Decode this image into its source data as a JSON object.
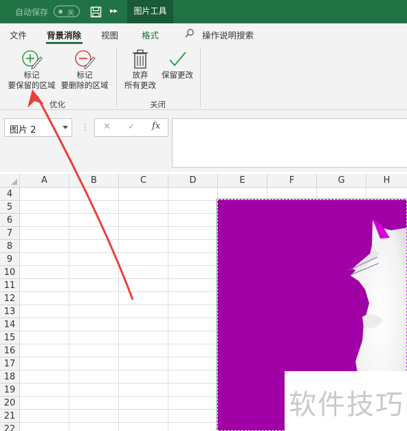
{
  "titlebar": {
    "autosave_label": "自动保存",
    "autosave_state": "关",
    "context_tab": "图片工具",
    "save_icon": "save-icon",
    "more_icon": "more-commands-icon",
    "bg_color": "#217346"
  },
  "ribbon_tabs": {
    "file": "文件",
    "background_removal": "背景消除",
    "view": "视图",
    "format": "格式",
    "search": "操作说明搜索"
  },
  "ribbon": {
    "mark_keep_line1": "标记",
    "mark_keep_line2": "要保留的区域",
    "mark_remove_line1": "标记",
    "mark_remove_line2": "要删除的区域",
    "group_refine": "优化",
    "discard_line1": "放弃",
    "discard_line2": "所有更改",
    "keep_changes": "保留更改",
    "group_close": "关闭"
  },
  "formula_bar": {
    "name_box": "图片 2",
    "fx": "fx",
    "content": ""
  },
  "sheet": {
    "columns": [
      "A",
      "B",
      "C",
      "D",
      "E",
      "F",
      "G",
      "H"
    ],
    "rows": [
      "4",
      "5",
      "6",
      "7",
      "8",
      "9",
      "10",
      "11",
      "12",
      "13",
      "14",
      "15",
      "16",
      "17",
      "18",
      "19",
      "20",
      "21",
      "22"
    ]
  },
  "picture": {
    "bg_color": "#a100a6",
    "watermark": "软件技巧"
  },
  "annotation": {
    "arrow_color": "#e8413b"
  }
}
